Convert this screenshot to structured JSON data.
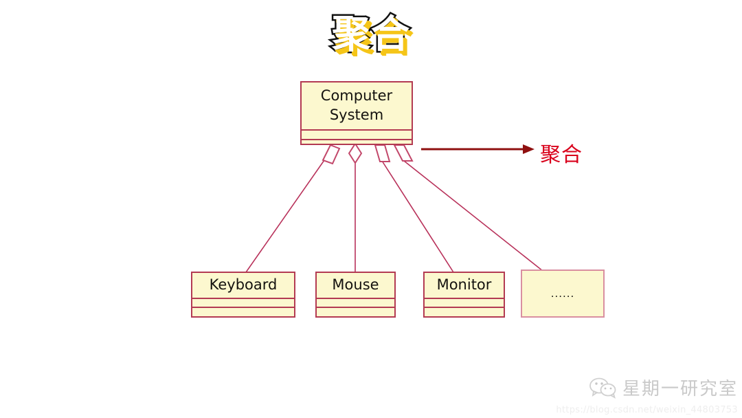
{
  "title": "聚合",
  "diagram": {
    "type": "uml-class-aggregation",
    "root": {
      "name": "Computer System",
      "compartments": 2
    },
    "parts": [
      {
        "name": "Keyboard",
        "compartments": 2,
        "relation": "aggregation"
      },
      {
        "name": "Mouse",
        "compartments": 2,
        "relation": "aggregation"
      },
      {
        "name": "Monitor",
        "compartments": 2,
        "relation": "aggregation"
      },
      {
        "name": "......",
        "compartments": 0,
        "relation": "aggregation"
      }
    ]
  },
  "legend": {
    "label": "聚合",
    "arrow_icon": "right-arrow-icon"
  },
  "watermark": {
    "icon": "wechat-icon",
    "name": "星期一研究室",
    "url": "https://blog.csdn.net/weixin_44803753"
  },
  "colors": {
    "box_fill": "#fcf8cf",
    "box_border": "#b33a52",
    "box_border_soft": "#d98fa0",
    "link": "#b8315a",
    "legend_arrow": "#8f1010",
    "legend_text": "#d9001b",
    "title_fill": "#ffffff",
    "title_outline": "#111111",
    "title_shadow": "#f5c518"
  }
}
